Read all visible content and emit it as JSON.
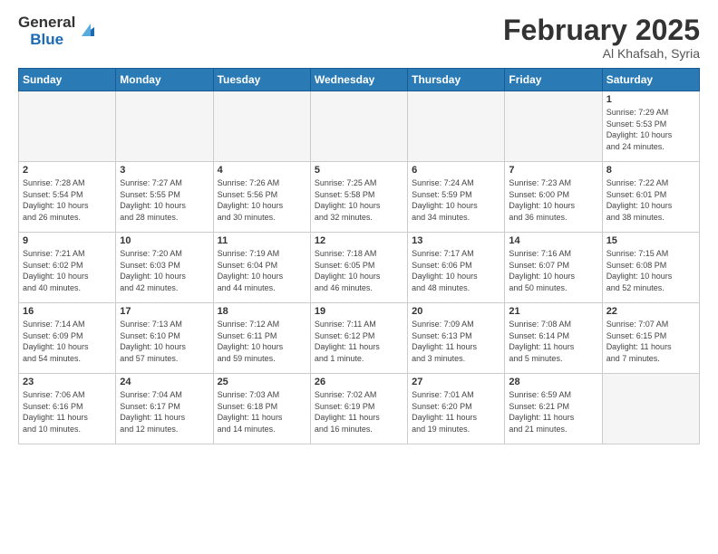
{
  "header": {
    "logo_general": "General",
    "logo_blue": "Blue",
    "title": "February 2025",
    "subtitle": "Al Khafsah, Syria"
  },
  "weekdays": [
    "Sunday",
    "Monday",
    "Tuesday",
    "Wednesday",
    "Thursday",
    "Friday",
    "Saturday"
  ],
  "weeks": [
    [
      {
        "day": "",
        "info": ""
      },
      {
        "day": "",
        "info": ""
      },
      {
        "day": "",
        "info": ""
      },
      {
        "day": "",
        "info": ""
      },
      {
        "day": "",
        "info": ""
      },
      {
        "day": "",
        "info": ""
      },
      {
        "day": "1",
        "info": "Sunrise: 7:29 AM\nSunset: 5:53 PM\nDaylight: 10 hours\nand 24 minutes."
      }
    ],
    [
      {
        "day": "2",
        "info": "Sunrise: 7:28 AM\nSunset: 5:54 PM\nDaylight: 10 hours\nand 26 minutes."
      },
      {
        "day": "3",
        "info": "Sunrise: 7:27 AM\nSunset: 5:55 PM\nDaylight: 10 hours\nand 28 minutes."
      },
      {
        "day": "4",
        "info": "Sunrise: 7:26 AM\nSunset: 5:56 PM\nDaylight: 10 hours\nand 30 minutes."
      },
      {
        "day": "5",
        "info": "Sunrise: 7:25 AM\nSunset: 5:58 PM\nDaylight: 10 hours\nand 32 minutes."
      },
      {
        "day": "6",
        "info": "Sunrise: 7:24 AM\nSunset: 5:59 PM\nDaylight: 10 hours\nand 34 minutes."
      },
      {
        "day": "7",
        "info": "Sunrise: 7:23 AM\nSunset: 6:00 PM\nDaylight: 10 hours\nand 36 minutes."
      },
      {
        "day": "8",
        "info": "Sunrise: 7:22 AM\nSunset: 6:01 PM\nDaylight: 10 hours\nand 38 minutes."
      }
    ],
    [
      {
        "day": "9",
        "info": "Sunrise: 7:21 AM\nSunset: 6:02 PM\nDaylight: 10 hours\nand 40 minutes."
      },
      {
        "day": "10",
        "info": "Sunrise: 7:20 AM\nSunset: 6:03 PM\nDaylight: 10 hours\nand 42 minutes."
      },
      {
        "day": "11",
        "info": "Sunrise: 7:19 AM\nSunset: 6:04 PM\nDaylight: 10 hours\nand 44 minutes."
      },
      {
        "day": "12",
        "info": "Sunrise: 7:18 AM\nSunset: 6:05 PM\nDaylight: 10 hours\nand 46 minutes."
      },
      {
        "day": "13",
        "info": "Sunrise: 7:17 AM\nSunset: 6:06 PM\nDaylight: 10 hours\nand 48 minutes."
      },
      {
        "day": "14",
        "info": "Sunrise: 7:16 AM\nSunset: 6:07 PM\nDaylight: 10 hours\nand 50 minutes."
      },
      {
        "day": "15",
        "info": "Sunrise: 7:15 AM\nSunset: 6:08 PM\nDaylight: 10 hours\nand 52 minutes."
      }
    ],
    [
      {
        "day": "16",
        "info": "Sunrise: 7:14 AM\nSunset: 6:09 PM\nDaylight: 10 hours\nand 54 minutes."
      },
      {
        "day": "17",
        "info": "Sunrise: 7:13 AM\nSunset: 6:10 PM\nDaylight: 10 hours\nand 57 minutes."
      },
      {
        "day": "18",
        "info": "Sunrise: 7:12 AM\nSunset: 6:11 PM\nDaylight: 10 hours\nand 59 minutes."
      },
      {
        "day": "19",
        "info": "Sunrise: 7:11 AM\nSunset: 6:12 PM\nDaylight: 11 hours\nand 1 minute."
      },
      {
        "day": "20",
        "info": "Sunrise: 7:09 AM\nSunset: 6:13 PM\nDaylight: 11 hours\nand 3 minutes."
      },
      {
        "day": "21",
        "info": "Sunrise: 7:08 AM\nSunset: 6:14 PM\nDaylight: 11 hours\nand 5 minutes."
      },
      {
        "day": "22",
        "info": "Sunrise: 7:07 AM\nSunset: 6:15 PM\nDaylight: 11 hours\nand 7 minutes."
      }
    ],
    [
      {
        "day": "23",
        "info": "Sunrise: 7:06 AM\nSunset: 6:16 PM\nDaylight: 11 hours\nand 10 minutes."
      },
      {
        "day": "24",
        "info": "Sunrise: 7:04 AM\nSunset: 6:17 PM\nDaylight: 11 hours\nand 12 minutes."
      },
      {
        "day": "25",
        "info": "Sunrise: 7:03 AM\nSunset: 6:18 PM\nDaylight: 11 hours\nand 14 minutes."
      },
      {
        "day": "26",
        "info": "Sunrise: 7:02 AM\nSunset: 6:19 PM\nDaylight: 11 hours\nand 16 minutes."
      },
      {
        "day": "27",
        "info": "Sunrise: 7:01 AM\nSunset: 6:20 PM\nDaylight: 11 hours\nand 19 minutes."
      },
      {
        "day": "28",
        "info": "Sunrise: 6:59 AM\nSunset: 6:21 PM\nDaylight: 11 hours\nand 21 minutes."
      },
      {
        "day": "",
        "info": ""
      }
    ]
  ]
}
